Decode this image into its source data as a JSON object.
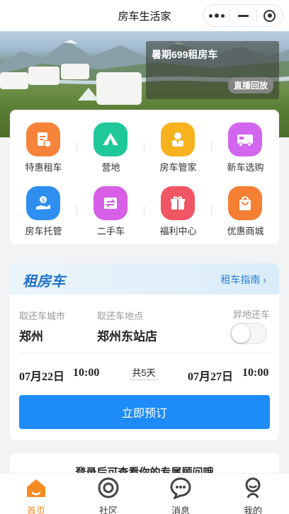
{
  "app": {
    "title": "房车生活家"
  },
  "capsule": {
    "more_icon": "more-dots-icon",
    "minimize_icon": "minimize-icon",
    "close_icon": "record-circle-icon"
  },
  "banner": {
    "title": "暑期699租房车",
    "badge": "直播回放"
  },
  "features": [
    {
      "label": "特惠租车",
      "icon": "document-coupon-icon",
      "color": "#f5833a"
    },
    {
      "label": "营地",
      "icon": "tent-icon",
      "color": "#20c79a"
    },
    {
      "label": "房车管家",
      "icon": "butler-icon",
      "color": "#f7b21e"
    },
    {
      "label": "新车选购",
      "icon": "rv-car-icon",
      "color": "#d366ee"
    },
    {
      "label": "房车托管",
      "icon": "hand-coin-icon",
      "color": "#2f8ff0"
    },
    {
      "label": "二手车",
      "icon": "swap-car-icon",
      "color": "#d65fe6"
    },
    {
      "label": "福利中心",
      "icon": "gift-icon",
      "color": "#f05664"
    },
    {
      "label": "优惠商城",
      "icon": "shopping-bag-icon",
      "color": "#f57f33"
    }
  ],
  "rent": {
    "title": "租房车",
    "guide": "租车指南 ›",
    "city_label": "取还车城市",
    "city_value": "郑州",
    "location_label": "取还车地点",
    "location_value": "郑州东站店",
    "other_return_label": "异地还车",
    "other_return_on": false,
    "pickup_date": "07月22日",
    "pickup_time": "10:00",
    "days": "共5天",
    "return_date": "07月27日",
    "return_time": "10:00",
    "book_button": "立即预订"
  },
  "bottom_card": {
    "title": "登录后可查看你的专属顾问哦"
  },
  "tabs": [
    {
      "label": "首页",
      "icon": "home-icon",
      "active": true
    },
    {
      "label": "社区",
      "icon": "community-icon",
      "active": false
    },
    {
      "label": "消息",
      "icon": "message-icon",
      "active": false
    },
    {
      "label": "我的",
      "icon": "profile-icon",
      "active": false
    }
  ],
  "colors": {
    "accent": "#1e8cf8",
    "tab_active": "#f58a1f",
    "rent_title": "#1f72c8"
  }
}
